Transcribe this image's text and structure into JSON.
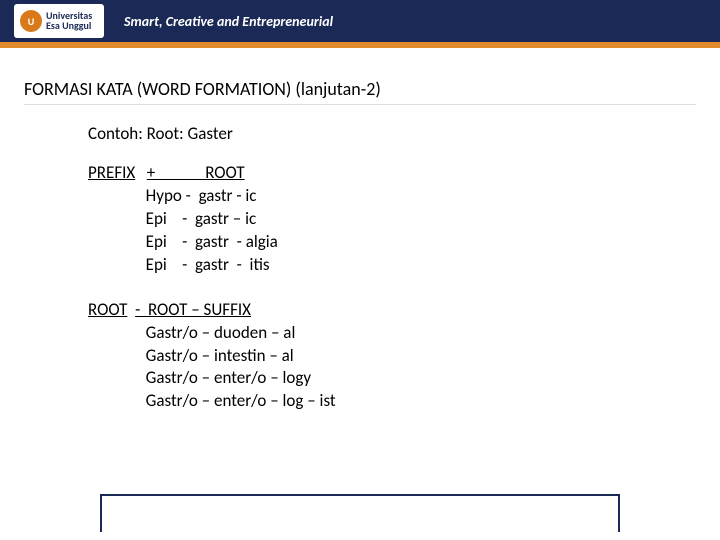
{
  "header": {
    "logo_small": "Universitas",
    "logo_main": "Esa Unggul",
    "tagline": "Smart, Creative and Entrepreneurial"
  },
  "title": "FORMASI KATA (WORD FORMATION) (lanjutan-2)",
  "example_intro": "Contoh:   Root: Gaster",
  "section1": {
    "header_left": "PREFIX",
    "header_right": "+             ROOT",
    "lines": [
      "Hypo -  gastr - ic",
      "Epi    -  gastr – ic",
      "Epi    -  gastr  - algia",
      "Epi    -  gastr  -  itis"
    ]
  },
  "section2": {
    "header_left": "ROOT",
    "header_right": "-  ROOT – SUFFIX",
    "lines": [
      "Gastr/o – duoden – al",
      "Gastr/o – intestin – al",
      "Gastr/o – enter/o – logy",
      "Gastr/o – enter/o – log – ist"
    ]
  }
}
